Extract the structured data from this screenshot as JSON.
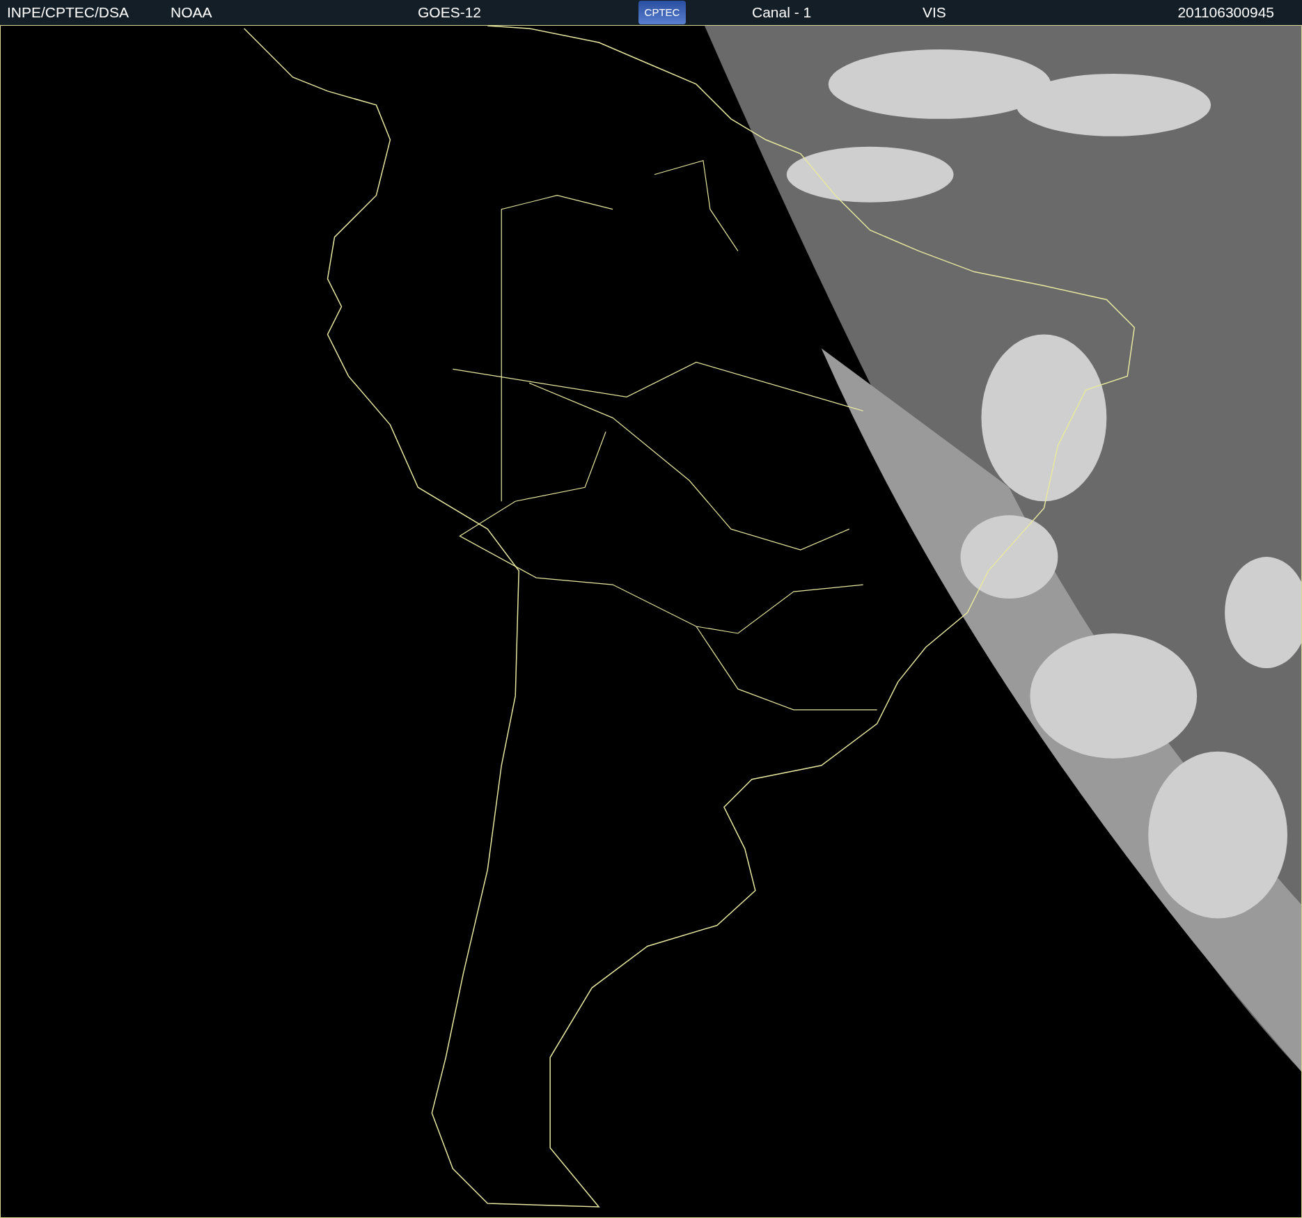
{
  "header": {
    "source": "INPE/CPTEC/DSA",
    "agency": "NOAA",
    "satellite": "GOES-12",
    "logo": "CPTEC",
    "channel": "Canal - 1",
    "band": "VIS",
    "timestamp": "201106300945"
  }
}
